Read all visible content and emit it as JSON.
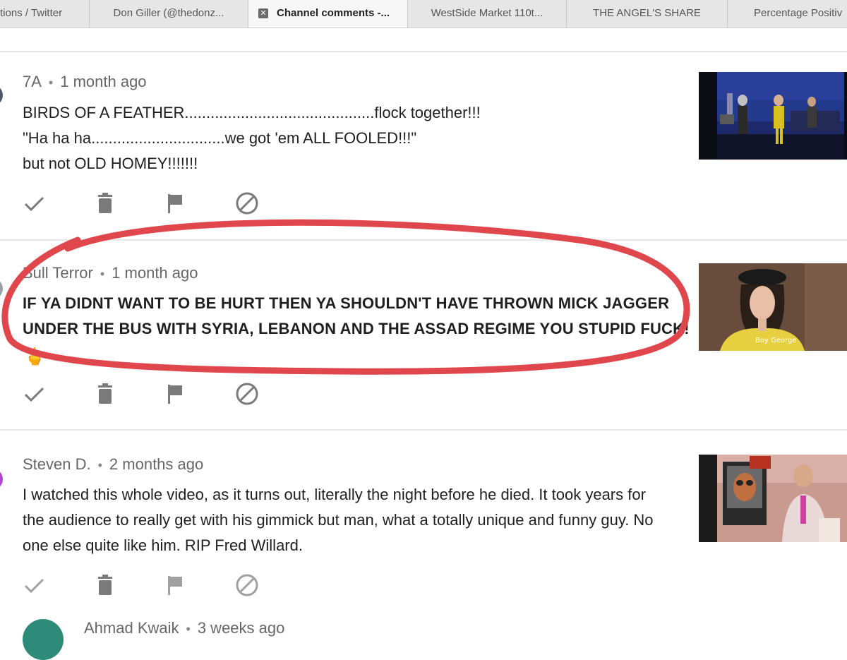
{
  "tabs": [
    {
      "label": "tions / Twitter"
    },
    {
      "label": "Don Giller (@thedonz..."
    },
    {
      "label": "Channel comments -..."
    },
    {
      "label": "WestSide Market 110t..."
    },
    {
      "label": "THE ANGEL'S SHARE"
    },
    {
      "label": "Percentage Positiv"
    }
  ],
  "comments": [
    {
      "author": "7A",
      "time": "1 month ago",
      "lines": [
        "BIRDS OF A FEATHER............................................flock together!!!",
        "\"Ha ha ha...............................we got 'em ALL FOOLED!!!\"",
        "but not OLD HOMEY!!!!!!!"
      ]
    },
    {
      "author": "Bull Terror",
      "time": "1 month ago",
      "lines": [
        "IF YA DIDNT WANT TO BE HURT THEN YA SHOULDN'T HAVE THROWN MICK JAGGER",
        "UNDER THE BUS WITH SYRIA, LEBANON AND THE ASSAD REGIME YOU STUPID FUCK!"
      ],
      "emoji": "🖕",
      "thumb_caption": "Boy George"
    },
    {
      "author": "Steven D.",
      "time": "2 months ago",
      "lines": [
        "I watched this whole video, as it turns out, literally the night before he died. It took years for",
        "the audience to really get with his gimmick but man, what a totally unique and funny guy. No",
        "one else quite like him. RIP Fred Willard."
      ]
    },
    {
      "author": "Ahmad Kwaik",
      "time": "3 weeks ago"
    }
  ],
  "separator": "•",
  "colors": {
    "annotation_red": "#e0474d",
    "icon_gray": "#7a7a7a",
    "avatar_teal": "#2e8b7a",
    "avatar_purple": "#b044d6"
  },
  "icons": [
    "approve-check-icon",
    "trash-icon",
    "flag-icon",
    "block-icon"
  ]
}
